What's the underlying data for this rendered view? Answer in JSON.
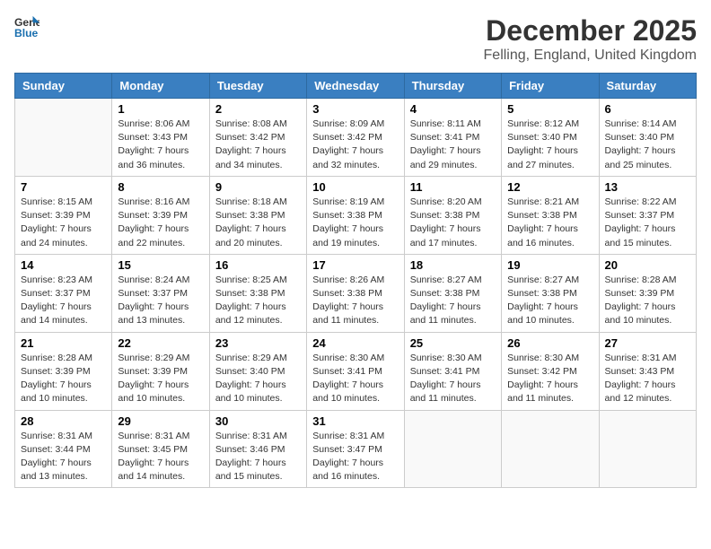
{
  "logo": {
    "general": "General",
    "blue": "Blue"
  },
  "title": "December 2025",
  "location": "Felling, England, United Kingdom",
  "days_of_week": [
    "Sunday",
    "Monday",
    "Tuesday",
    "Wednesday",
    "Thursday",
    "Friday",
    "Saturday"
  ],
  "weeks": [
    [
      {
        "day": "",
        "sunrise": "",
        "sunset": "",
        "daylight": ""
      },
      {
        "day": "1",
        "sunrise": "Sunrise: 8:06 AM",
        "sunset": "Sunset: 3:43 PM",
        "daylight": "Daylight: 7 hours and 36 minutes."
      },
      {
        "day": "2",
        "sunrise": "Sunrise: 8:08 AM",
        "sunset": "Sunset: 3:42 PM",
        "daylight": "Daylight: 7 hours and 34 minutes."
      },
      {
        "day": "3",
        "sunrise": "Sunrise: 8:09 AM",
        "sunset": "Sunset: 3:42 PM",
        "daylight": "Daylight: 7 hours and 32 minutes."
      },
      {
        "day": "4",
        "sunrise": "Sunrise: 8:11 AM",
        "sunset": "Sunset: 3:41 PM",
        "daylight": "Daylight: 7 hours and 29 minutes."
      },
      {
        "day": "5",
        "sunrise": "Sunrise: 8:12 AM",
        "sunset": "Sunset: 3:40 PM",
        "daylight": "Daylight: 7 hours and 27 minutes."
      },
      {
        "day": "6",
        "sunrise": "Sunrise: 8:14 AM",
        "sunset": "Sunset: 3:40 PM",
        "daylight": "Daylight: 7 hours and 25 minutes."
      }
    ],
    [
      {
        "day": "7",
        "sunrise": "Sunrise: 8:15 AM",
        "sunset": "Sunset: 3:39 PM",
        "daylight": "Daylight: 7 hours and 24 minutes."
      },
      {
        "day": "8",
        "sunrise": "Sunrise: 8:16 AM",
        "sunset": "Sunset: 3:39 PM",
        "daylight": "Daylight: 7 hours and 22 minutes."
      },
      {
        "day": "9",
        "sunrise": "Sunrise: 8:18 AM",
        "sunset": "Sunset: 3:38 PM",
        "daylight": "Daylight: 7 hours and 20 minutes."
      },
      {
        "day": "10",
        "sunrise": "Sunrise: 8:19 AM",
        "sunset": "Sunset: 3:38 PM",
        "daylight": "Daylight: 7 hours and 19 minutes."
      },
      {
        "day": "11",
        "sunrise": "Sunrise: 8:20 AM",
        "sunset": "Sunset: 3:38 PM",
        "daylight": "Daylight: 7 hours and 17 minutes."
      },
      {
        "day": "12",
        "sunrise": "Sunrise: 8:21 AM",
        "sunset": "Sunset: 3:38 PM",
        "daylight": "Daylight: 7 hours and 16 minutes."
      },
      {
        "day": "13",
        "sunrise": "Sunrise: 8:22 AM",
        "sunset": "Sunset: 3:37 PM",
        "daylight": "Daylight: 7 hours and 15 minutes."
      }
    ],
    [
      {
        "day": "14",
        "sunrise": "Sunrise: 8:23 AM",
        "sunset": "Sunset: 3:37 PM",
        "daylight": "Daylight: 7 hours and 14 minutes."
      },
      {
        "day": "15",
        "sunrise": "Sunrise: 8:24 AM",
        "sunset": "Sunset: 3:37 PM",
        "daylight": "Daylight: 7 hours and 13 minutes."
      },
      {
        "day": "16",
        "sunrise": "Sunrise: 8:25 AM",
        "sunset": "Sunset: 3:38 PM",
        "daylight": "Daylight: 7 hours and 12 minutes."
      },
      {
        "day": "17",
        "sunrise": "Sunrise: 8:26 AM",
        "sunset": "Sunset: 3:38 PM",
        "daylight": "Daylight: 7 hours and 11 minutes."
      },
      {
        "day": "18",
        "sunrise": "Sunrise: 8:27 AM",
        "sunset": "Sunset: 3:38 PM",
        "daylight": "Daylight: 7 hours and 11 minutes."
      },
      {
        "day": "19",
        "sunrise": "Sunrise: 8:27 AM",
        "sunset": "Sunset: 3:38 PM",
        "daylight": "Daylight: 7 hours and 10 minutes."
      },
      {
        "day": "20",
        "sunrise": "Sunrise: 8:28 AM",
        "sunset": "Sunset: 3:39 PM",
        "daylight": "Daylight: 7 hours and 10 minutes."
      }
    ],
    [
      {
        "day": "21",
        "sunrise": "Sunrise: 8:28 AM",
        "sunset": "Sunset: 3:39 PM",
        "daylight": "Daylight: 7 hours and 10 minutes."
      },
      {
        "day": "22",
        "sunrise": "Sunrise: 8:29 AM",
        "sunset": "Sunset: 3:39 PM",
        "daylight": "Daylight: 7 hours and 10 minutes."
      },
      {
        "day": "23",
        "sunrise": "Sunrise: 8:29 AM",
        "sunset": "Sunset: 3:40 PM",
        "daylight": "Daylight: 7 hours and 10 minutes."
      },
      {
        "day": "24",
        "sunrise": "Sunrise: 8:30 AM",
        "sunset": "Sunset: 3:41 PM",
        "daylight": "Daylight: 7 hours and 10 minutes."
      },
      {
        "day": "25",
        "sunrise": "Sunrise: 8:30 AM",
        "sunset": "Sunset: 3:41 PM",
        "daylight": "Daylight: 7 hours and 11 minutes."
      },
      {
        "day": "26",
        "sunrise": "Sunrise: 8:30 AM",
        "sunset": "Sunset: 3:42 PM",
        "daylight": "Daylight: 7 hours and 11 minutes."
      },
      {
        "day": "27",
        "sunrise": "Sunrise: 8:31 AM",
        "sunset": "Sunset: 3:43 PM",
        "daylight": "Daylight: 7 hours and 12 minutes."
      }
    ],
    [
      {
        "day": "28",
        "sunrise": "Sunrise: 8:31 AM",
        "sunset": "Sunset: 3:44 PM",
        "daylight": "Daylight: 7 hours and 13 minutes."
      },
      {
        "day": "29",
        "sunrise": "Sunrise: 8:31 AM",
        "sunset": "Sunset: 3:45 PM",
        "daylight": "Daylight: 7 hours and 14 minutes."
      },
      {
        "day": "30",
        "sunrise": "Sunrise: 8:31 AM",
        "sunset": "Sunset: 3:46 PM",
        "daylight": "Daylight: 7 hours and 15 minutes."
      },
      {
        "day": "31",
        "sunrise": "Sunrise: 8:31 AM",
        "sunset": "Sunset: 3:47 PM",
        "daylight": "Daylight: 7 hours and 16 minutes."
      },
      {
        "day": "",
        "sunrise": "",
        "sunset": "",
        "daylight": ""
      },
      {
        "day": "",
        "sunrise": "",
        "sunset": "",
        "daylight": ""
      },
      {
        "day": "",
        "sunrise": "",
        "sunset": "",
        "daylight": ""
      }
    ]
  ]
}
